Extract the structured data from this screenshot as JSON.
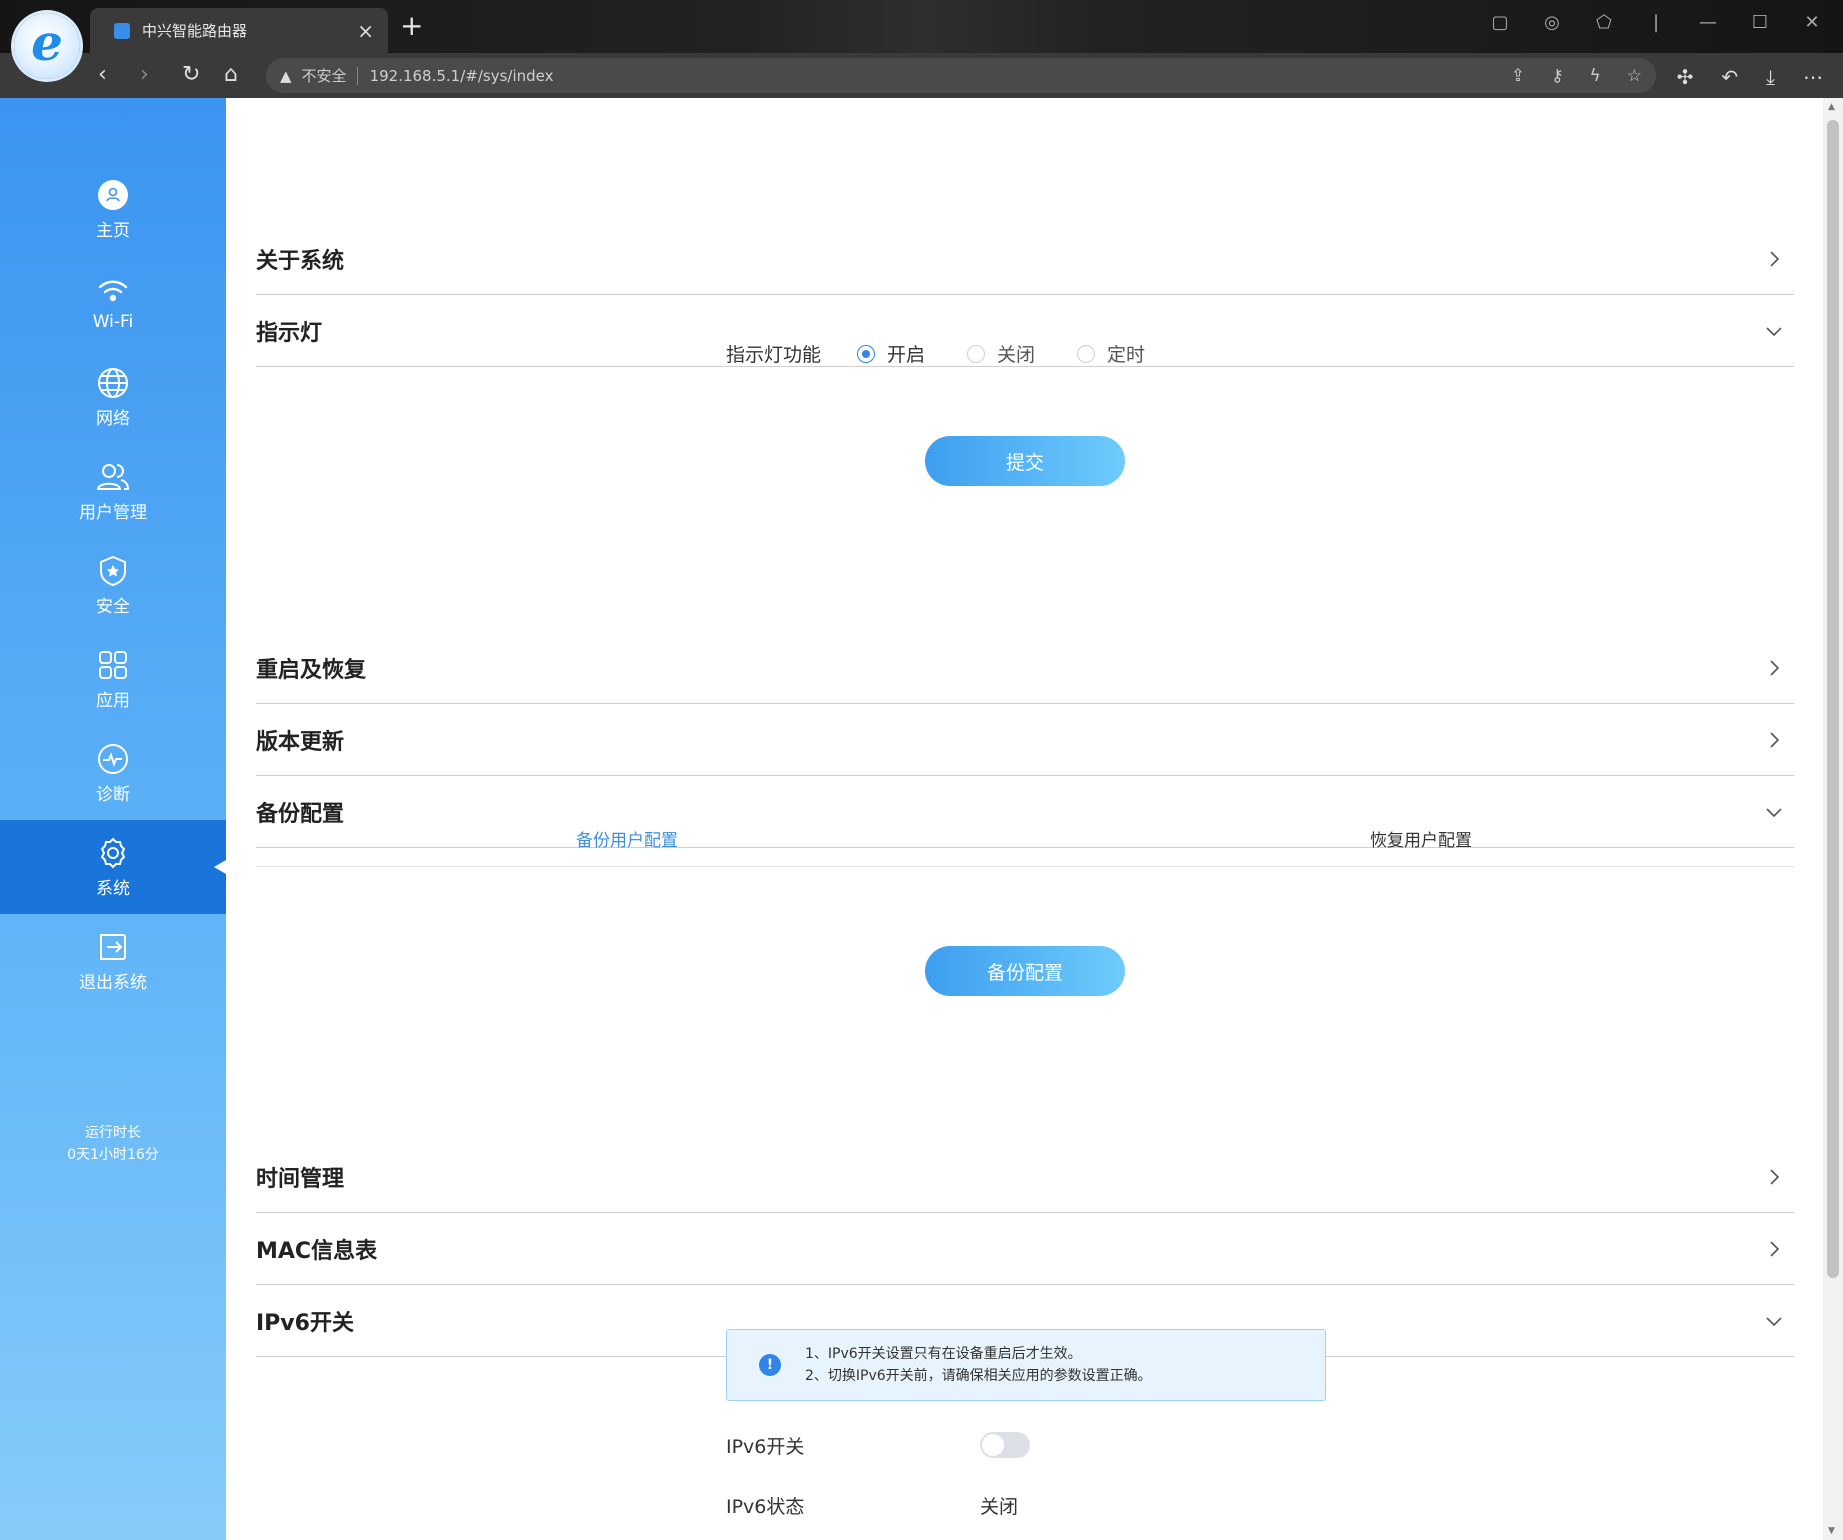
{
  "browser": {
    "tab_title": "中兴智能路由器",
    "new_tab": "+",
    "close": "×",
    "insecure_label": "不安全",
    "url": "192.168.5.1/#/sys/index"
  },
  "sidebar": {
    "items": [
      {
        "label": "主页",
        "icon": "home-user-icon"
      },
      {
        "label": "Wi-Fi",
        "icon": "wifi-icon"
      },
      {
        "label": "网络",
        "icon": "globe-icon"
      },
      {
        "label": "用户管理",
        "icon": "users-icon"
      },
      {
        "label": "安全",
        "icon": "shield-icon"
      },
      {
        "label": "应用",
        "icon": "apps-grid-icon"
      },
      {
        "label": "诊断",
        "icon": "pulse-icon"
      },
      {
        "label": "系统",
        "icon": "gear-icon",
        "active": true
      },
      {
        "label": "退出系统",
        "icon": "logout-icon"
      }
    ],
    "uptime_label": "运行时长",
    "uptime_value": "0天1小时16分"
  },
  "sections": {
    "about": "关于系统",
    "led": "指示灯",
    "reboot": "重启及恢复",
    "update": "版本更新",
    "backup": "备份配置",
    "time": "时间管理",
    "mac": "MAC信息表",
    "ipv6": "IPv6开关"
  },
  "led": {
    "label": "指示灯功能",
    "options": [
      "开启",
      "关闭",
      "定时"
    ],
    "selected": "开启",
    "submit": "提交"
  },
  "backup": {
    "tabs": [
      "备份用户配置",
      "恢复用户配置"
    ],
    "active_tab": "备份用户配置",
    "button": "备份配置"
  },
  "ipv6": {
    "notice": [
      "1、IPv6开关设置只有在设备重启后才生效。",
      "2、切换IPv6开关前，请确保相关应用的参数设置正确。"
    ],
    "switch_label": "IPv6开关",
    "switch_on": false,
    "status_label": "IPv6状态",
    "status_value": "关闭"
  },
  "colors": {
    "accent": "#2f86e8",
    "sidebar_active": "#1a75db"
  }
}
